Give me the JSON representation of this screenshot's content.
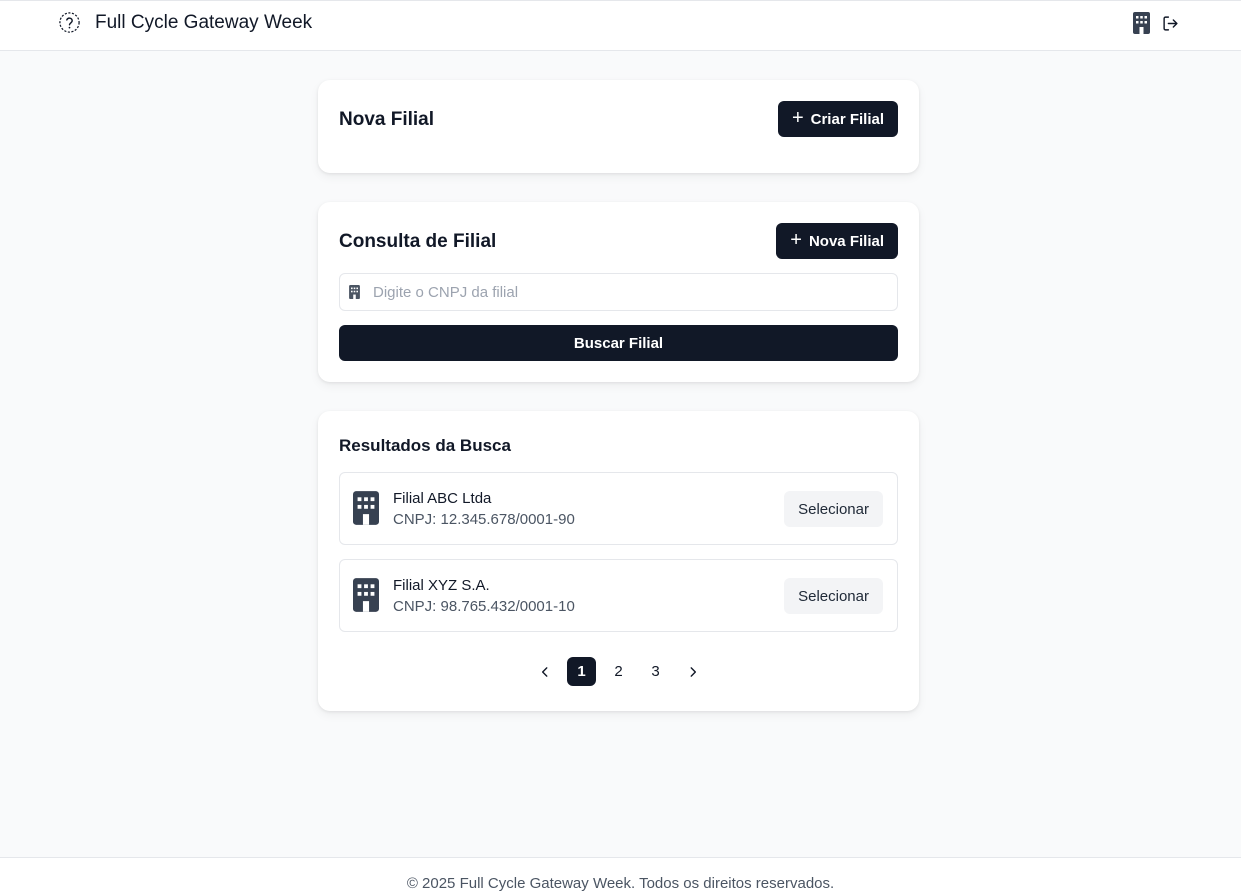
{
  "header": {
    "title": "Full Cycle Gateway Week",
    "icons": {
      "logo": "help-circle-icon",
      "branch": "building-icon",
      "logout": "logout-icon"
    }
  },
  "new_branch_card": {
    "title": "Nova Filial",
    "create_button_label": "Criar Filial"
  },
  "query_card": {
    "title": "Consulta de Filial",
    "new_button_label": "Nova Filial",
    "search": {
      "placeholder": "Digite o CNPJ da filial",
      "value": ""
    },
    "search_button_label": "Buscar Filial"
  },
  "results_card": {
    "title": "Resultados da Busca",
    "items": [
      {
        "name": "Filial ABC Ltda",
        "cnpj": "CNPJ: 12.345.678/0001-90",
        "select_label": "Selecionar"
      },
      {
        "name": "Filial XYZ S.A.",
        "cnpj": "CNPJ: 98.765.432/0001-10",
        "select_label": "Selecionar"
      }
    ],
    "pagination": {
      "pages": [
        "1",
        "2",
        "3"
      ],
      "current": "1"
    }
  },
  "footer": {
    "text": "© 2025 Full Cycle Gateway Week. Todos os direitos reservados."
  },
  "colors": {
    "primary": "#111827",
    "background": "#f9fafb",
    "muted_button": "#f3f4f6",
    "border": "#e5e7eb",
    "secondary_text": "#4b5563"
  }
}
